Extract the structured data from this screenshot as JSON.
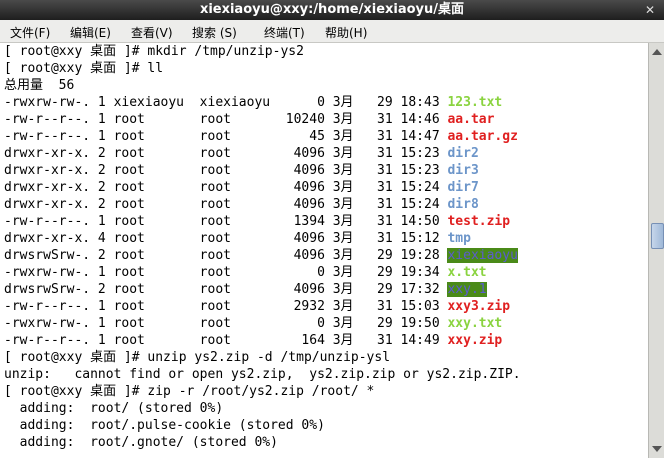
{
  "window": {
    "title": "xiexiaoyu@xxy:/home/xiexiaoyu/桌面",
    "close_icon": "close-icon"
  },
  "menu": [
    "文件(F)",
    "编辑(E)",
    "查看(V)",
    "搜索 (S)",
    "终端(T)",
    "帮助(H)"
  ],
  "terminal": {
    "prompt": "[ root@xxy 桌面 ]# ",
    "commands": {
      "mkdir": "mkdir /tmp/unzip-ys2",
      "ll": "ll",
      "unzip": "unzip ys2.zip -d /tmp/unzip-ysl",
      "zip": "zip -r /root/ys2.zip /root/ *"
    },
    "total": "总用量  56",
    "listing": [
      {
        "perm": "-rwxrw-rw-.",
        "links": "1",
        "owner": "xiexiaoyu",
        "group": "xiexiaoyu",
        "size": "0",
        "month": "3月",
        "day": "29",
        "time": "18:43",
        "name": "123.txt",
        "color": "green"
      },
      {
        "perm": "-rw-r--r--.",
        "links": "1",
        "owner": "root",
        "group": "root",
        "size": "10240",
        "month": "3月",
        "day": "31",
        "time": "14:46",
        "name": "aa.tar",
        "color": "red"
      },
      {
        "perm": "-rw-r--r--.",
        "links": "1",
        "owner": "root",
        "group": "root",
        "size": "45",
        "month": "3月",
        "day": "31",
        "time": "14:47",
        "name": "aa.tar.gz",
        "color": "red"
      },
      {
        "perm": "drwxr-xr-x.",
        "links": "2",
        "owner": "root",
        "group": "root",
        "size": "4096",
        "month": "3月",
        "day": "31",
        "time": "15:23",
        "name": "dir2",
        "color": "blue"
      },
      {
        "perm": "drwxr-xr-x.",
        "links": "2",
        "owner": "root",
        "group": "root",
        "size": "4096",
        "month": "3月",
        "day": "31",
        "time": "15:23",
        "name": "dir3",
        "color": "blue"
      },
      {
        "perm": "drwxr-xr-x.",
        "links": "2",
        "owner": "root",
        "group": "root",
        "size": "4096",
        "month": "3月",
        "day": "31",
        "time": "15:24",
        "name": "dir7",
        "color": "blue"
      },
      {
        "perm": "drwxr-xr-x.",
        "links": "2",
        "owner": "root",
        "group": "root",
        "size": "4096",
        "month": "3月",
        "day": "31",
        "time": "15:24",
        "name": "dir8",
        "color": "blue"
      },
      {
        "perm": "-rw-r--r--.",
        "links": "1",
        "owner": "root",
        "group": "root",
        "size": "1394",
        "month": "3月",
        "day": "31",
        "time": "14:50",
        "name": "test.zip",
        "color": "red"
      },
      {
        "perm": "drwxr-xr-x.",
        "links": "4",
        "owner": "root",
        "group": "root",
        "size": "4096",
        "month": "3月",
        "day": "31",
        "time": "15:12",
        "name": "tmp",
        "color": "blue"
      },
      {
        "perm": "drwsrwSrw-.",
        "links": "2",
        "owner": "root",
        "group": "root",
        "size": "4096",
        "month": "3月",
        "day": "29",
        "time": "19:28",
        "name": "xiexiaoyu",
        "color": "highlight"
      },
      {
        "perm": "-rwxrw-rw-.",
        "links": "1",
        "owner": "root",
        "group": "root",
        "size": "0",
        "month": "3月",
        "day": "29",
        "time": "19:34",
        "name": "x.txt",
        "color": "green"
      },
      {
        "perm": "drwsrwSrw-.",
        "links": "2",
        "owner": "root",
        "group": "root",
        "size": "4096",
        "month": "3月",
        "day": "29",
        "time": "17:32",
        "name": "xxy.1",
        "color": "highlight"
      },
      {
        "perm": "-rw-r--r--.",
        "links": "1",
        "owner": "root",
        "group": "root",
        "size": "2932",
        "month": "3月",
        "day": "31",
        "time": "15:03",
        "name": "xxy3.zip",
        "color": "red"
      },
      {
        "perm": "-rwxrw-rw-.",
        "links": "1",
        "owner": "root",
        "group": "root",
        "size": "0",
        "month": "3月",
        "day": "29",
        "time": "19:50",
        "name": "xxy.txt",
        "color": "green"
      },
      {
        "perm": "-rw-r--r--.",
        "links": "1",
        "owner": "root",
        "group": "root",
        "size": "164",
        "month": "3月",
        "day": "31",
        "time": "14:49",
        "name": "xxy.zip",
        "color": "red"
      }
    ],
    "unzip_error": "unzip:   cannot find or open ys2.zip,  ys2.zip.zip or ys2.zip.ZIP.",
    "adding": [
      "  adding:  root/ (stored 0%)",
      "  adding:  root/.pulse-cookie (stored 0%)",
      "  adding:  root/.gnote/ (stored 0%)"
    ]
  },
  "colors": {
    "green": "#8ad33f",
    "red": "#e02020",
    "blue": "#6c95c9",
    "highlight_bg": "#4a8a18",
    "highlight_fg": "#5b5bd0"
  }
}
